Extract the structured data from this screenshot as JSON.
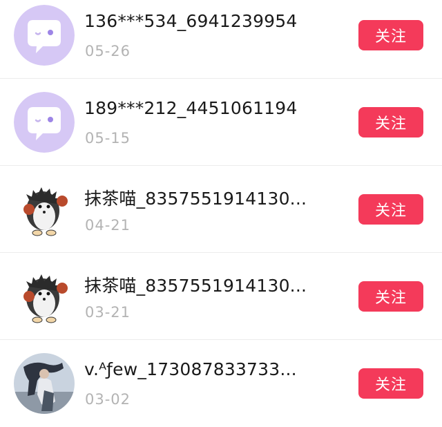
{
  "accent_color": "#f43a5a",
  "users": [
    {
      "name": "136***534_6941239954",
      "date": "05-26",
      "follow_label": "关注",
      "avatar_icon": "chat-bubble-icon"
    },
    {
      "name": "189***212_4451061194",
      "date": "05-15",
      "follow_label": "关注",
      "avatar_icon": "chat-bubble-icon"
    },
    {
      "name": "抹茶喵_8357551914130...",
      "date": "04-21",
      "follow_label": "关注",
      "avatar_icon": "hedgehog-boxer-icon"
    },
    {
      "name": "抹茶喵_8357551914130...",
      "date": "03-21",
      "follow_label": "关注",
      "avatar_icon": "hedgehog-boxer-icon"
    },
    {
      "name": "v.ᴬƒew_173087833733...",
      "date": "03-02",
      "follow_label": "关注",
      "avatar_icon": "photo-avatar"
    }
  ]
}
